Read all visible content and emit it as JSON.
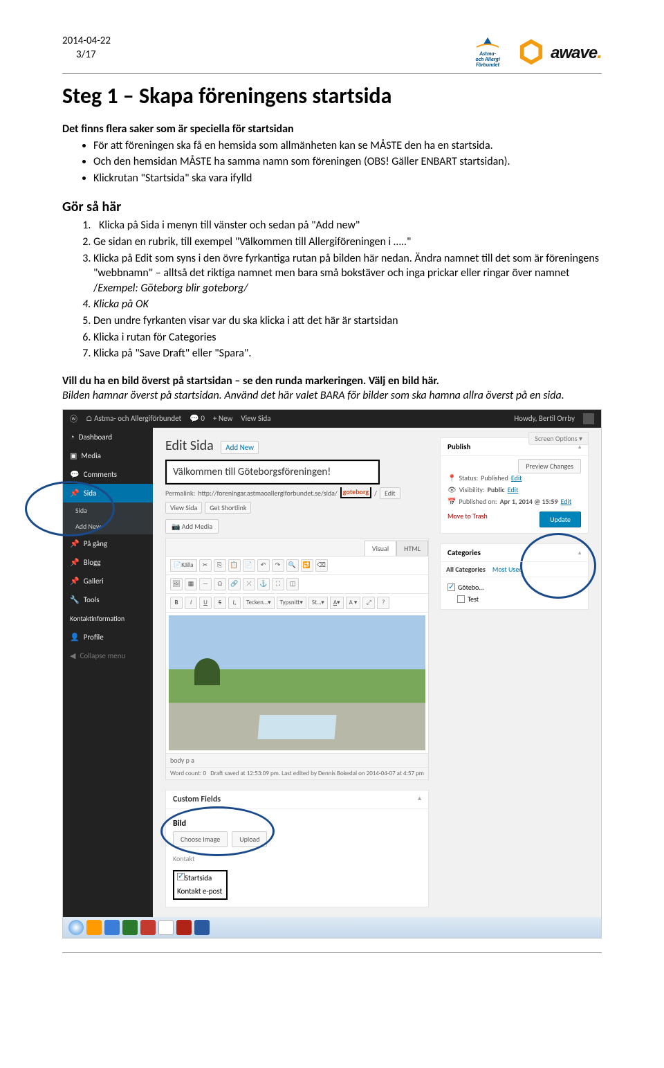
{
  "header": {
    "date": "2014-04-22",
    "page": "3/17",
    "logo1_line1": "Astma-",
    "logo1_line2": "och Allergi",
    "logo1_line3": "Förbundet",
    "logo3": "awave"
  },
  "h1": "Steg 1 – Skapa föreningens startsida",
  "intro_head": "Det finns flera saker som är speciella för startsidan",
  "bullets": [
    "För att föreningen ska få en hemsida som allmänheten kan se MÅSTE den ha en startsida.",
    "Och den hemsidan MÅSTE ha samma namn som föreningen (OBS! Gäller ENBART startsidan).",
    "Klickrutan \"Startsida\" ska vara ifylld"
  ],
  "gor_head": "Gör så här",
  "steps": {
    "s1": "Klicka på Sida i menyn till vänster och sedan på \"Add new\"",
    "s2": "Ge sidan en rubrik, till exempel  \"Välkommen till Allergiföreningen i …..\"",
    "s3a": "Klicka på Edit som syns i den övre fyrkantiga rutan på bilden här nedan. Ändra namnet till det som är föreningens \"webbnamn\" – alltså det  riktiga  namnet men bara små bokstäver och inga prickar eller ringar över namnet /",
    "s3b": "Exempel: Göteborg blir goteborg/",
    "s4": "Klicka på OK",
    "s5": "Den undre fyrkanten visar var du ska klicka i att det här är startsidan",
    "s6": "Klicka i rutan för Categories",
    "s7": "Klicka på \"Save Draft\" eller \"Spara\"."
  },
  "marker_bold": "Vill du ha en bild överst på startsidan – se den runda markeringen. Välj en bild här.",
  "marker_italic": "Bilden hamnar överst på startsidan. Använd det här valet BARA för bilder som ska hamna allra överst på en sida.",
  "wp": {
    "top": {
      "site": "Astma- och Allergiförbundet",
      "comments": "0",
      "new": "New",
      "view": "View Sida",
      "howdy": "Howdy, Bertil Orrby"
    },
    "side": {
      "dashboard": "Dashboard",
      "media": "Media",
      "comments": "Comments",
      "sida": "Sida",
      "sida_sub1": "Sida",
      "sida_sub2": "Add New",
      "pagang": "På gång",
      "blogg": "Blogg",
      "galleri": "Galleri",
      "tools": "Tools",
      "kontakt": "Kontaktinformation",
      "profile": "Profile",
      "collapse": "Collapse menu"
    },
    "main": {
      "screen_opts": "Screen Options ▾",
      "title": "Edit Sida",
      "addnew": "Add New",
      "post_title": "Välkommen till Göteborgsföreningen!",
      "permalink_label": "Permalink:",
      "permalink_url": "http://foreningar.astmaoallergiforbundet.se/sida/",
      "slug": "goteborg",
      "edit": "Edit",
      "viewsida": "View Sida",
      "getshort": "Get Shortlink",
      "addmedia": "Add Media",
      "tab_visual": "Visual",
      "tab_html": "HTML",
      "tb": {
        "kalla": "Källa",
        "tecken": "Tecken…",
        "typsnitt": "Typsnitt",
        "st": "St…"
      },
      "status_path": "body  p  a",
      "footer_left": "Word count: 0",
      "footer_right": "Draft saved at 12:53:09 pm. Last edited by Dennis Bokedal on 2014-04-07 at 4:57 pm",
      "cf_head": "Custom Fields",
      "cf_bild": "Bild",
      "cf_choose": "Choose Image",
      "cf_upload": "Upload",
      "cf_kontakt_hidden": "Kontakt",
      "cf_startsida": "Startsida",
      "cf_kontakt": "Kontakt e-post"
    },
    "sidebox": {
      "publish_h": "Publish",
      "preview": "Preview Changes",
      "status_l": "Status:",
      "status_v": "Published",
      "status_edit": "Edit",
      "vis_l": "Visibility:",
      "vis_v": "Public",
      "vis_edit": "Edit",
      "pub_l": "Published on:",
      "pub_v": "Apr 1, 2014 @ 15:59",
      "pub_edit": "Edit",
      "trash": "Move to Trash",
      "update": "Update",
      "cat_h": "Categories",
      "cat_tab1": "All Categories",
      "cat_tab2": "Most Used",
      "cat_item1": "Götebo…",
      "cat_item2": "Test"
    }
  }
}
